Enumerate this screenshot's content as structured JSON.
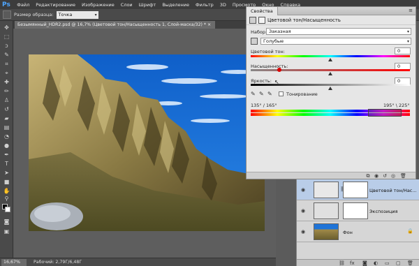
{
  "app": {
    "logo": "Ps"
  },
  "menu": [
    "Файл",
    "Редактирование",
    "Изображение",
    "Слои",
    "Шрифт",
    "Выделение",
    "Фильтр",
    "3D",
    "Просмотр",
    "Окно",
    "Справка"
  ],
  "options": {
    "sample_label": "Размер образца:",
    "sample_value": "Точка"
  },
  "document": {
    "tab_title": "Безымянный_HDR2.psd @ 16,7% (Цветовой тон/Насыщенность 1, Слой-маска/32) * ×"
  },
  "status": {
    "zoom": "16,67%",
    "info": "Рабочий: 2,79Г/6,48Г"
  },
  "properties": {
    "tab": "Свойства",
    "heading": "Цветовой тон/Насыщенность",
    "preset_label": "Набор:",
    "preset_value": "Заказная",
    "channel_value": "Голубые",
    "hue_label": "Цветовой тон:",
    "hue_value": "0",
    "saturation_label": "Насыщенность:",
    "saturation_value": "0",
    "lightness_label": "Яркость:",
    "lightness_value": "0",
    "colorize_label": "Тонирование",
    "range_left": "135° / 165°",
    "range_right": "195° \\ 225°"
  },
  "layers": [
    {
      "name": "Цветовой тон/Нас...",
      "selected": true
    },
    {
      "name": "Экспозиция",
      "selected": false
    },
    {
      "name": "Фон",
      "selected": false
    }
  ],
  "colors": {
    "accent": "#4fa6ff",
    "selected_layer": "#b9cde8",
    "sky": "#1f74d8"
  }
}
